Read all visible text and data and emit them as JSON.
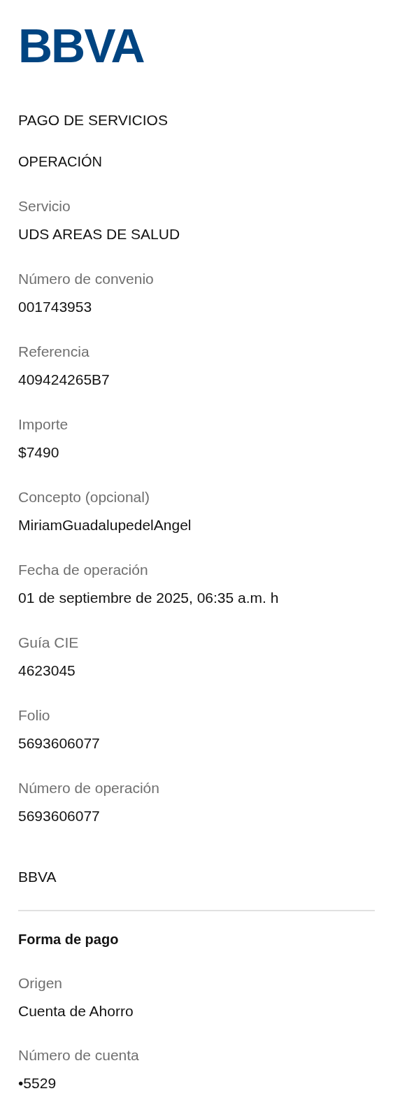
{
  "logo": "BBVA",
  "title": "PAGO DE SERVICIOS",
  "section": "OPERACIÓN",
  "fields": [
    {
      "label": "Servicio",
      "value": "UDS AREAS DE SALUD"
    },
    {
      "label": "Número de convenio",
      "value": "001743953"
    },
    {
      "label": "Referencia",
      "value": "409424265B7"
    },
    {
      "label": "Importe",
      "value": "$7490"
    },
    {
      "label": "Concepto (opcional)",
      "value": "MiriamGuadalupedelAngel"
    },
    {
      "label": "Fecha de operación",
      "value": "01 de septiembre de 2025, 06:35 a.m. h"
    },
    {
      "label": "Guía CIE",
      "value": "4623045"
    },
    {
      "label": "Folio",
      "value": "5693606077"
    },
    {
      "label": "Número de operación",
      "value": "5693606077"
    }
  ],
  "bank": "BBVA",
  "payment": {
    "title": "Forma de pago",
    "fields": [
      {
        "label": "Origen",
        "value": "Cuenta de Ahorro"
      },
      {
        "label": "Número de cuenta",
        "value": "•5529"
      }
    ]
  }
}
